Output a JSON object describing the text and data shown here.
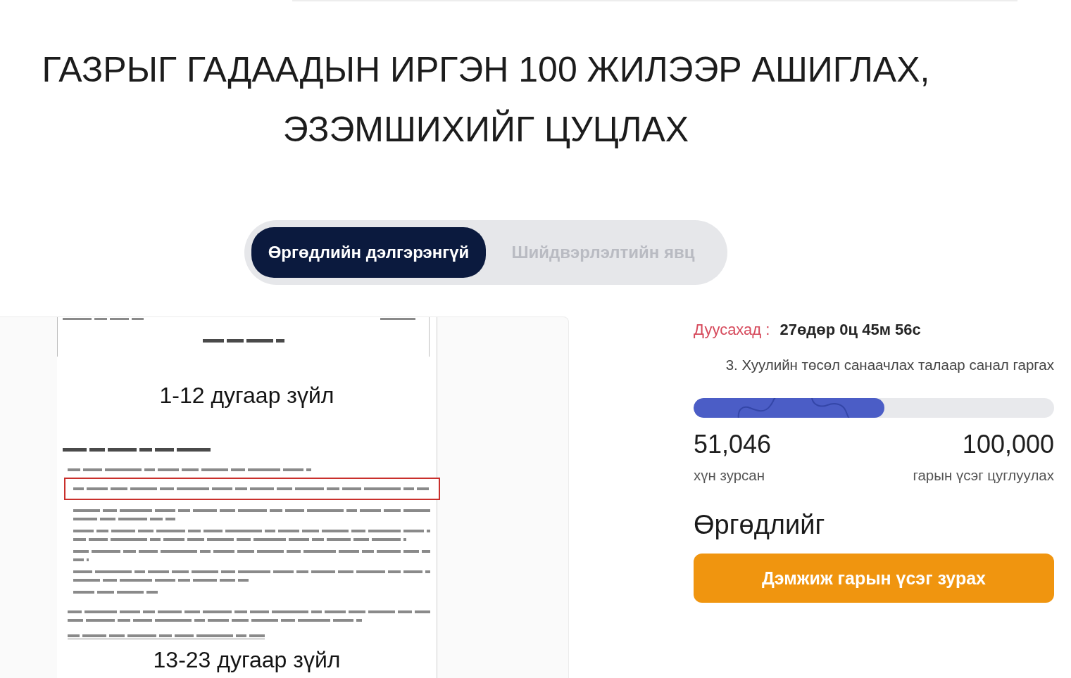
{
  "title": "ГАЗРЫГ ГАДААДЫН ИРГЭН 100 ЖИЛЭЭР АШИГЛАХ, ЭЗЭМШИХИЙГ ЦУЦЛАХ",
  "tabs": [
    {
      "label": "Өргөдлийн дэлгэрэнгүй",
      "selected": true
    },
    {
      "label": "Шийдвэрлэлтийн явц",
      "selected": false
    }
  ],
  "document": {
    "sections": [
      {
        "heading": "1-12 дугаар зүйл",
        "paragraphs": [
          {
            "kind": "article_title",
            "highlighted": false
          },
          {
            "kind": "clause",
            "highlighted": false
          },
          {
            "kind": "subclause",
            "highlighted": true
          },
          {
            "kind": "subclause",
            "highlighted": false
          },
          {
            "kind": "subclause",
            "highlighted": false
          },
          {
            "kind": "subclause",
            "highlighted": false
          },
          {
            "kind": "subclause",
            "highlighted": false
          },
          {
            "kind": "subclause",
            "highlighted": false
          },
          {
            "kind": "clause",
            "highlighted": false
          },
          {
            "kind": "note",
            "highlighted": false
          }
        ]
      },
      {
        "heading": "13-23 дугаар зүйл"
      }
    ]
  },
  "petition": {
    "deadline_label": "Дуусахад :",
    "deadline_value": "27өдөр 0ц 45м 56с",
    "category": "3. Хуулийн төсөл санаачлах талаар санал гаргах",
    "progress": {
      "level": 0.53
    },
    "signed_count": "51,046",
    "signed_label": "хүн зурсан",
    "goal_count": "100,000",
    "goal_label": "гарын үсэг цуглуулах",
    "heading": "Өргөдлийг",
    "sign_button": "Дэмжиж гарын үсэг зурах"
  }
}
